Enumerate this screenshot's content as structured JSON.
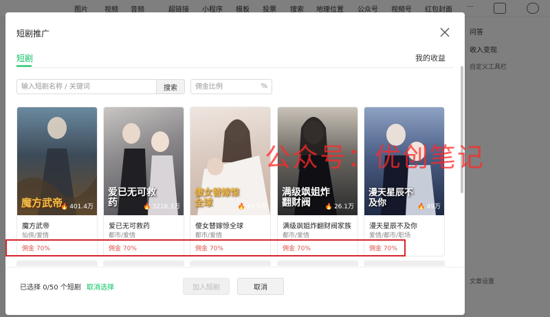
{
  "toolbar": {
    "items": [
      "图片",
      "视频",
      "音频",
      "超链接",
      "小程序",
      "模板",
      "投票",
      "搜索",
      "地理位置",
      "公众号",
      "视频号",
      "红包封面",
      "···"
    ]
  },
  "right_panel": {
    "qa": "问答",
    "monetize": "收入变现",
    "custom_tools": "自定义工具栏",
    "text_settings": "文章设置"
  },
  "dialog": {
    "title": "短剧推广",
    "tab_label": "短剧",
    "earnings_link": "我的收益",
    "search_placeholder": "输入短剧名称 / 关键词",
    "search_button": "搜索",
    "commission_placeholder": "佣金比例",
    "percent_sign": "%"
  },
  "dramas": [
    {
      "name": "魔方武帝",
      "genre": "仙侠/爱情",
      "views": "401.4万",
      "poster_text": "魔方武帝",
      "commission": "佣金 70%"
    },
    {
      "name": "爱已无可救药",
      "genre": "都市/爱情",
      "views": "3216.3万",
      "poster_text": "爱已无可救药",
      "commission": "佣金 70%"
    },
    {
      "name": "傻女替嫁惊全球",
      "genre": "都市/爱情",
      "views": "49.5万",
      "poster_text": "傻女替嫁惊全球",
      "commission": "佣金 70%"
    },
    {
      "name": "满级飒姐炸翻财阀家族",
      "genre": "都市/爱情",
      "views": "26.1万",
      "poster_text": "满级飒姐炸翻财阀",
      "commission": "佣金 70%"
    },
    {
      "name": "漫天星辰不及你",
      "genre": "爱情/都市/职场",
      "views": "49万",
      "poster_text": "漫天星辰不及你",
      "commission": "佣金 70%"
    }
  ],
  "footer": {
    "selected_prefix": "已选择",
    "selected_count": "0/50",
    "selected_suffix": "个短剧",
    "cancel_select": "取消选择",
    "join_button": "加入短剧",
    "cancel_button": "取消"
  },
  "watermark": "公众号：优创笔记",
  "colors": {
    "accent": "#07c160",
    "commission": "#e0524c",
    "highlight": "#d7222b"
  },
  "icons": [
    "close-icon",
    "fire-icon"
  ]
}
